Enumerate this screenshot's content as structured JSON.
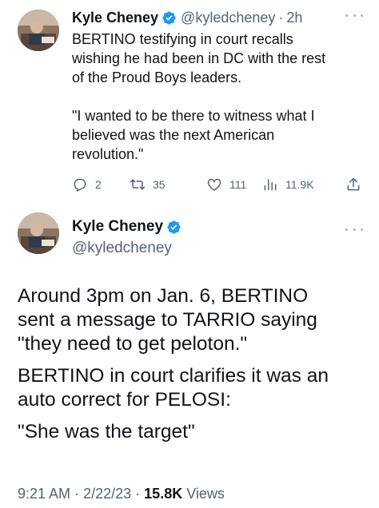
{
  "colors": {
    "text": "#0f1419",
    "secondary": "#536471",
    "verified_blue": "#1d9bf0",
    "background": "#ffffff"
  },
  "tweet1": {
    "author_name": "Kyle Cheney",
    "handle": "@kyledcheney",
    "separator": "·",
    "time": "2h",
    "paragraphs": [
      "BERTINO testifying in court recalls\nwishing he had been in DC with the rest\nof the Proud Boys leaders.",
      "\"I wanted to be there to witness what I\nbelieved was the next American\nrevolution.\""
    ],
    "actions": {
      "replies": "2",
      "retweets": "35",
      "likes": "111",
      "views": "11.9K"
    },
    "icons": [
      "verified-badge-icon",
      "more-icon",
      "reply-icon",
      "retweet-icon",
      "like-icon",
      "views-icon",
      "share-icon"
    ]
  },
  "tweet2": {
    "author_name": "Kyle Cheney",
    "handle": "@kyledcheney",
    "paragraphs": [
      "Around 3pm on Jan. 6, BERTINO\nsent a message to TARRIO saying\n\"they need to get peloton.\"",
      "BERTINO in court clarifies it was an\nauto correct for PELOSI:",
      "\"She was the target\""
    ],
    "meta": {
      "time": "9:21 AM",
      "separator1": "·",
      "date": "2/22/23",
      "separator2": "·",
      "views_count": "15.8K",
      "views_label": "Views"
    }
  }
}
